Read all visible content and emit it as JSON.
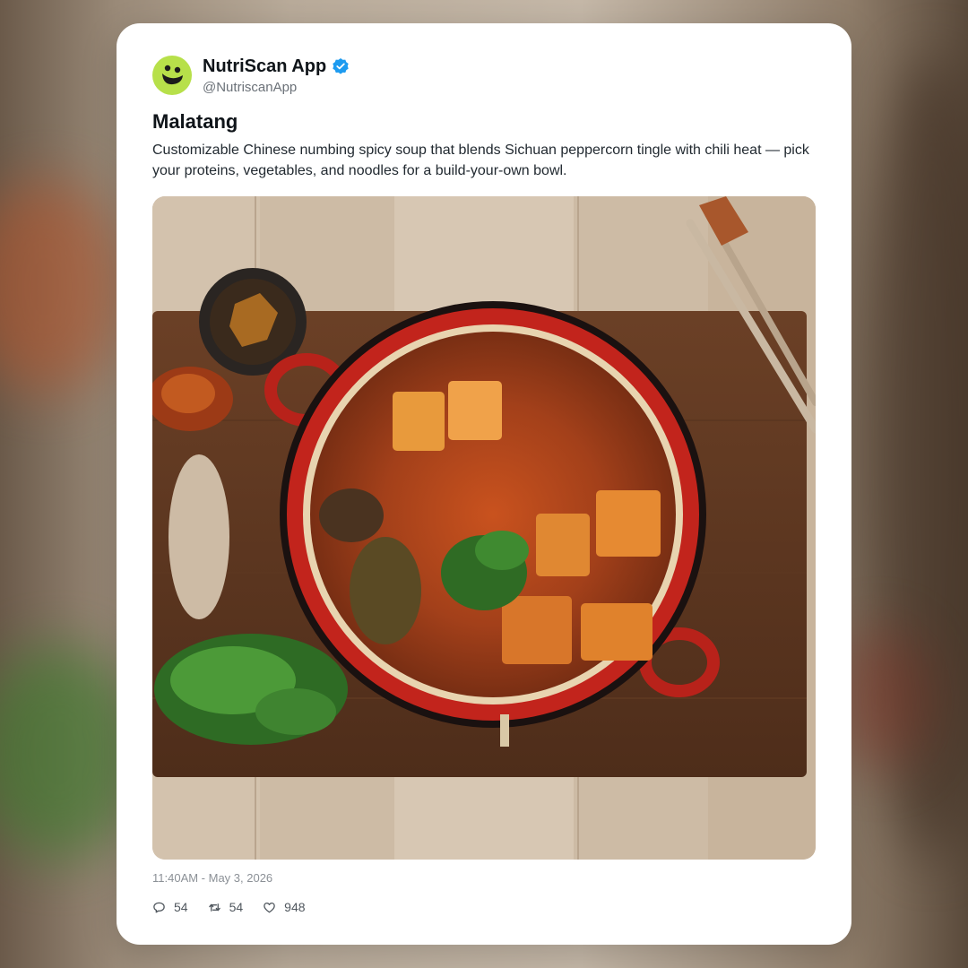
{
  "account": {
    "display_name": "NutriScan App",
    "handle": "@NutriscanApp",
    "avatar_icon": "smiley-logo-icon",
    "verified_icon": "verified-badge-icon",
    "avatar_color": "#b7e04a",
    "verified_color": "#1d9bf0"
  },
  "post": {
    "title": "Malatang",
    "body": "Customizable Chinese numbing spicy soup that blends Sichuan peppercorn tingle with chili heat — pick your proteins, vegetables, and noodles for a build-your-own bowl.",
    "image_icon": "malatang-photo",
    "timestamp": "11:40AM - May 3, 2026"
  },
  "actions": {
    "replies": {
      "icon": "reply-icon",
      "count": "54"
    },
    "reposts": {
      "icon": "repost-icon",
      "count": "54"
    },
    "likes": {
      "icon": "heart-icon",
      "count": "948"
    }
  }
}
